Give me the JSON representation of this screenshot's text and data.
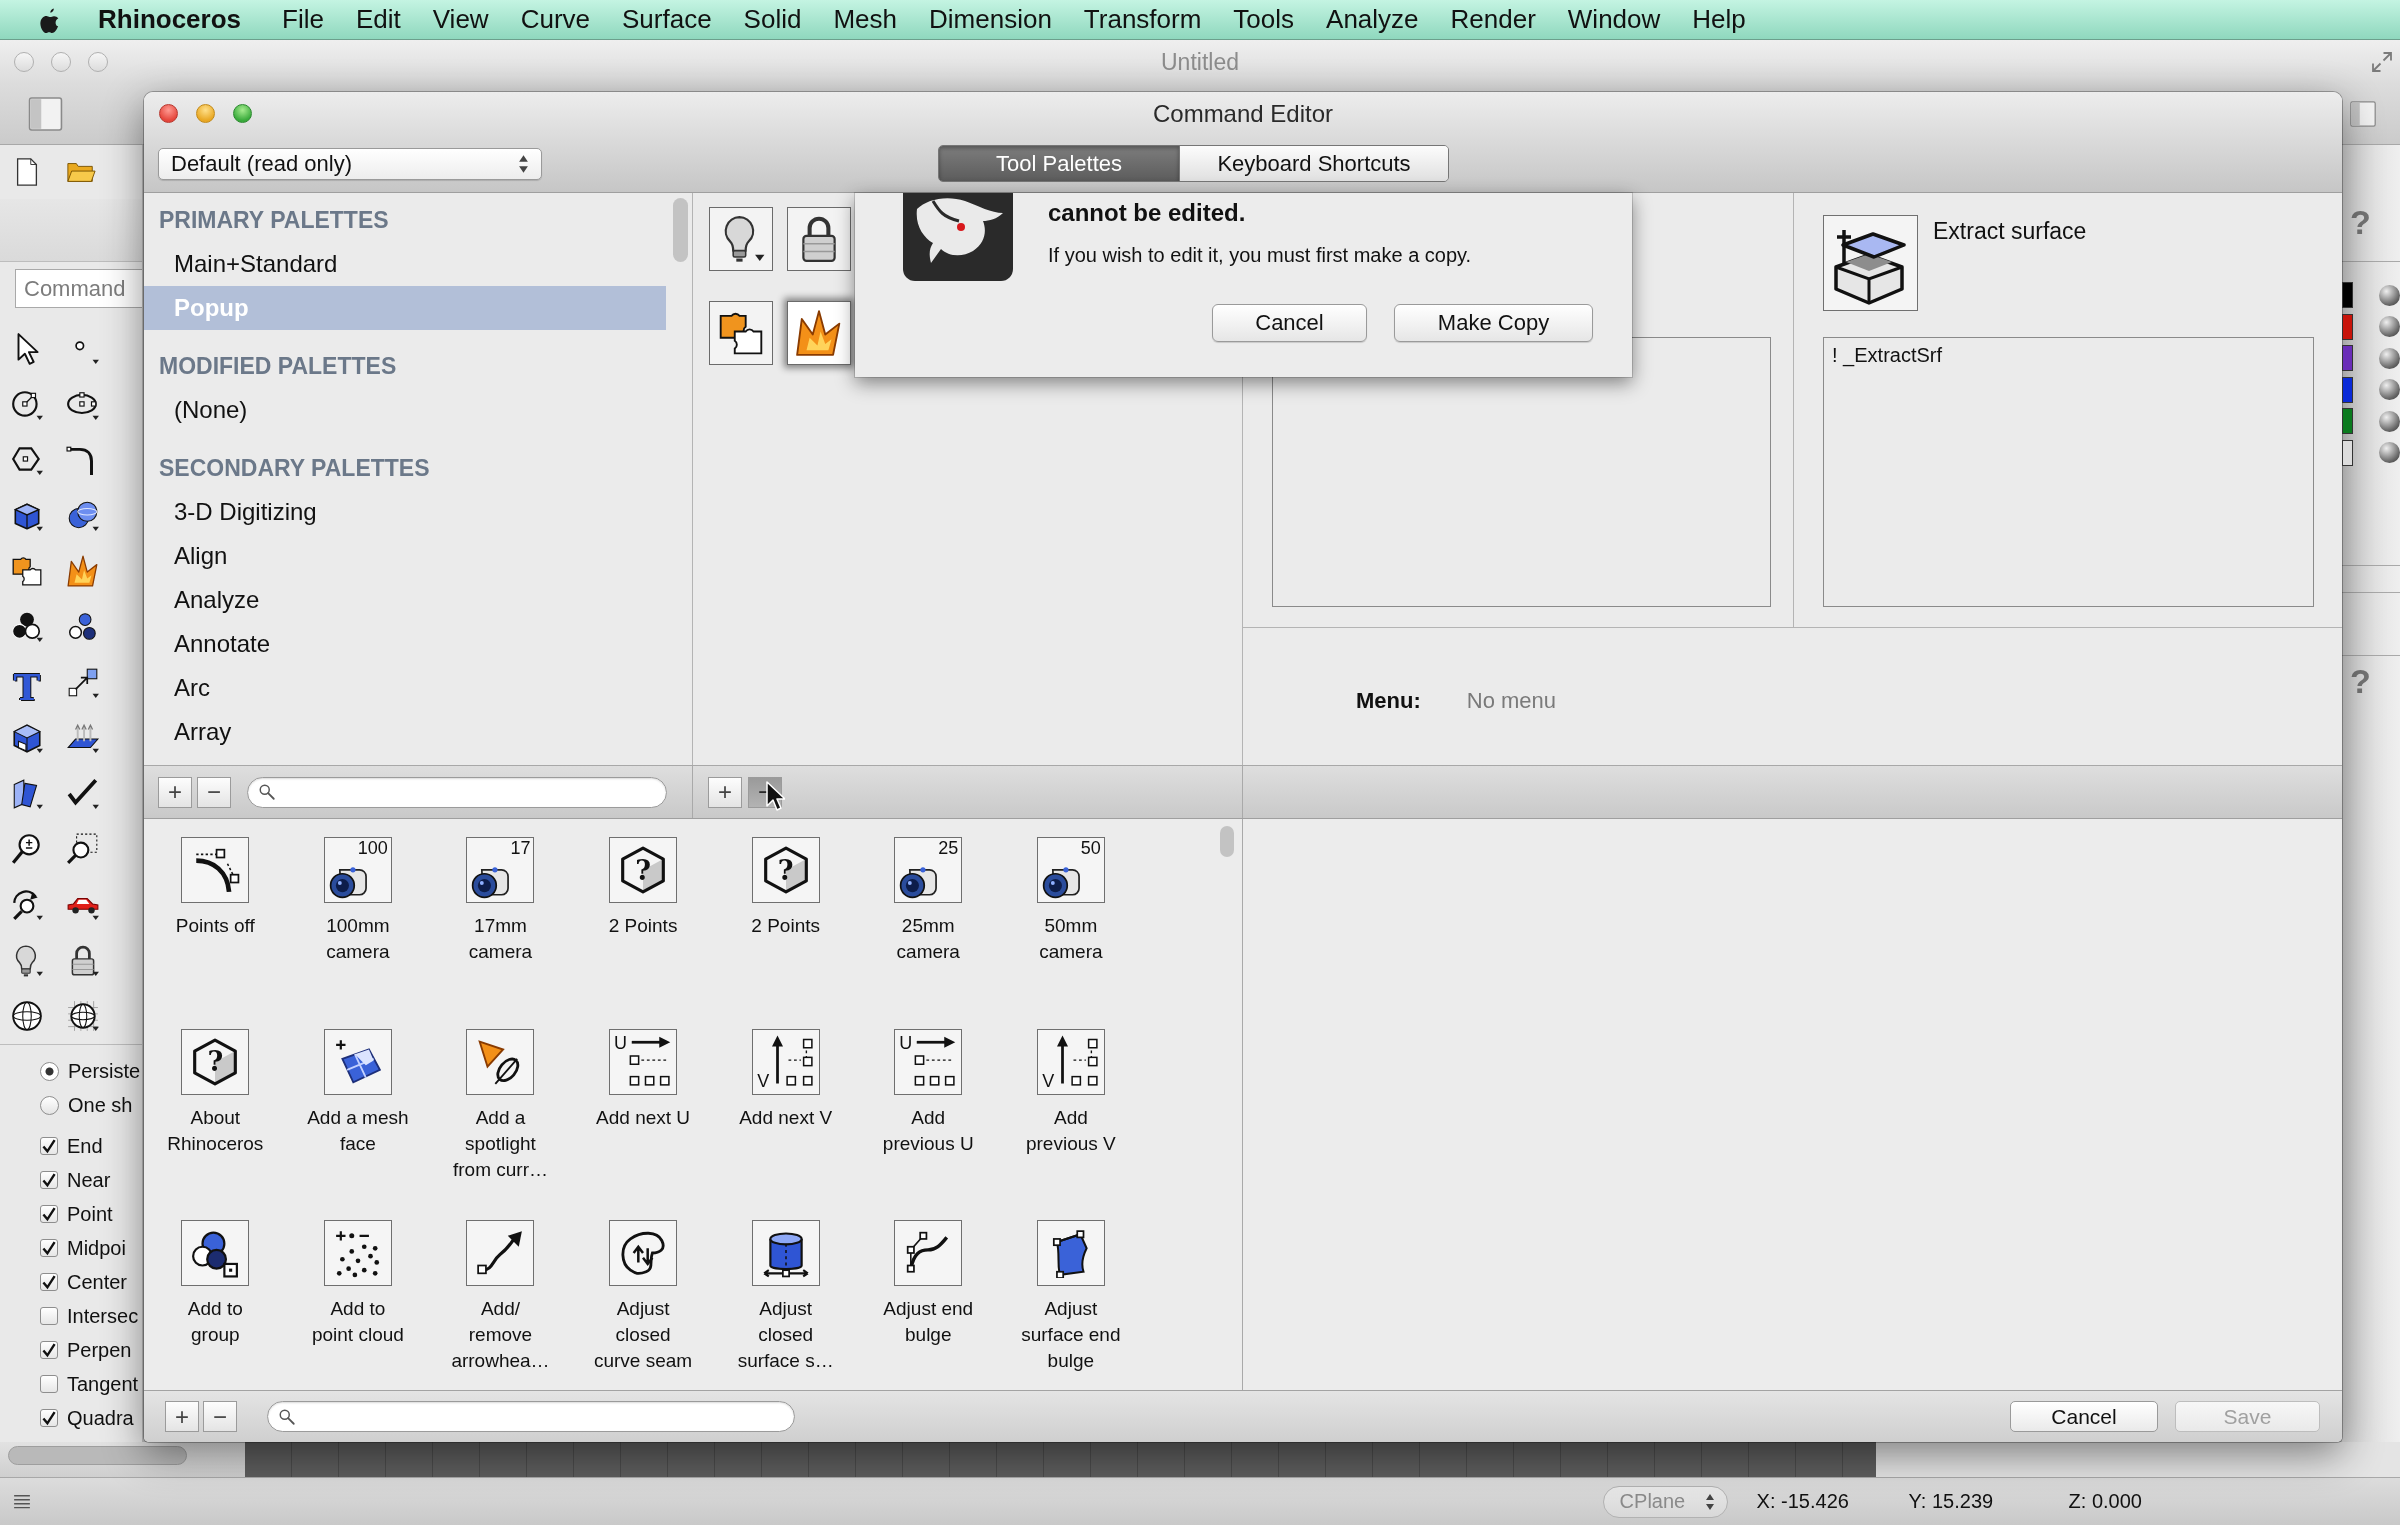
{
  "menu_bar": {
    "app_name": "Rhinoceros",
    "items": [
      "File",
      "Edit",
      "View",
      "Curve",
      "Surface",
      "Solid",
      "Mesh",
      "Dimension",
      "Transform",
      "Tools",
      "Analyze",
      "Render",
      "Window",
      "Help"
    ]
  },
  "main_window": {
    "title": "Untitled",
    "command_field": {
      "placeholder": "Command"
    },
    "toolbar_glyph": "T",
    "osnap_radios": [
      {
        "label": "Persiste",
        "selected": true
      },
      {
        "label": "One sh",
        "selected": false
      }
    ],
    "osnap_checkboxes": [
      {
        "label": "End",
        "checked": true
      },
      {
        "label": "Near",
        "checked": true
      },
      {
        "label": "Point",
        "checked": true
      },
      {
        "label": "Midpoi",
        "checked": true
      },
      {
        "label": "Center",
        "checked": true
      },
      {
        "label": "Intersec",
        "checked": false
      },
      {
        "label": "Perpen",
        "checked": true
      },
      {
        "label": "Tangent",
        "checked": false
      },
      {
        "label": "Quadra",
        "checked": true
      }
    ],
    "help_marks": [
      "?",
      "?"
    ],
    "layer_swatches": [
      {
        "color": "#000000"
      },
      {
        "color": "#c8140a"
      },
      {
        "color": "#6a2db8"
      },
      {
        "color": "#0a2ad8"
      },
      {
        "color": "#0a7a1e"
      },
      {
        "color": "#dcdcdc"
      }
    ],
    "status_bar": {
      "cplane": "CPlane",
      "x": "X: -15.426",
      "y": "Y: 15.239",
      "z": "Z: 0.000"
    }
  },
  "command_editor": {
    "title": "Command Editor",
    "palette_set": "Default (read only)",
    "tabs": [
      {
        "label": "Tool Palettes",
        "selected": true
      },
      {
        "label": "Keyboard Shortcuts",
        "selected": false
      }
    ],
    "palette_list": [
      {
        "heading": "PRIMARY PALETTES",
        "items": [
          {
            "label": "Main+Standard",
            "selected": false
          },
          {
            "label": "Popup",
            "selected": true
          }
        ]
      },
      {
        "heading": "MODIFIED PALETTES",
        "items": [
          {
            "label": "(None)",
            "selected": false
          }
        ]
      },
      {
        "heading": "SECONDARY PALETTES",
        "items": [
          {
            "label": "3-D Digitizing",
            "selected": false
          },
          {
            "label": "Align",
            "selected": false
          },
          {
            "label": "Analyze",
            "selected": false
          },
          {
            "label": "Annotate",
            "selected": false
          },
          {
            "label": "Arc",
            "selected": false
          },
          {
            "label": "Array",
            "selected": false
          }
        ]
      }
    ],
    "list_buttons": [
      {
        "label": "+"
      },
      {
        "label": "−"
      }
    ],
    "palette_buttons": [
      {
        "selected": false
      },
      {
        "selected": false
      },
      {
        "selected": false
      },
      {
        "selected": true
      }
    ],
    "palette_edit_buttons": [
      {
        "label": "+",
        "pressed": false
      },
      {
        "label": "−",
        "pressed": true
      }
    ],
    "alert": {
      "message": "cannot be edited.",
      "detail": "If you wish to edit it, you must first make a copy.",
      "buttons": [
        "Cancel",
        "Make Copy"
      ]
    },
    "button_properties": {
      "tooltip": "Extract surface",
      "macro": "! _ExtractSrf"
    },
    "menu": {
      "label": "Menu:",
      "value": "No menu"
    },
    "commands": [
      {
        "label": "Points off"
      },
      {
        "label": "100mm\ncamera",
        "badge": "100"
      },
      {
        "label": "17mm\ncamera",
        "badge": "17"
      },
      {
        "label": "2 Points",
        "badge": "?"
      },
      {
        "label": "2 Points",
        "badge": "?"
      },
      {
        "label": "25mm\ncamera",
        "badge": "25"
      },
      {
        "label": "50mm\ncamera",
        "badge": "50"
      },
      {
        "label": "About\nRhinoceros",
        "badge": "?"
      },
      {
        "label": "Add a mesh\nface"
      },
      {
        "label": "Add a\nspotlight\nfrom curr…"
      },
      {
        "label": "Add next U",
        "badge": "U"
      },
      {
        "label": "Add next V",
        "badge": "V"
      },
      {
        "label": "Add\nprevious U",
        "badge": "U"
      },
      {
        "label": "Add\nprevious V",
        "badge": "V"
      },
      {
        "label": "Add to\ngroup"
      },
      {
        "label": "Add to\npoint cloud"
      },
      {
        "label": "Add/\nremove\narrowhea…"
      },
      {
        "label": "Adjust\nclosed\ncurve seam"
      },
      {
        "label": "Adjust\nclosed\nsurface s…"
      },
      {
        "label": "Adjust end\nbulge"
      },
      {
        "label": "Adjust\nsurface end\nbulge"
      }
    ],
    "command_buttons": [
      {
        "label": "+"
      },
      {
        "label": "−"
      }
    ],
    "footer_buttons": [
      {
        "label": "Cancel",
        "disabled": false
      },
      {
        "label": "Save",
        "disabled": true
      }
    ]
  }
}
